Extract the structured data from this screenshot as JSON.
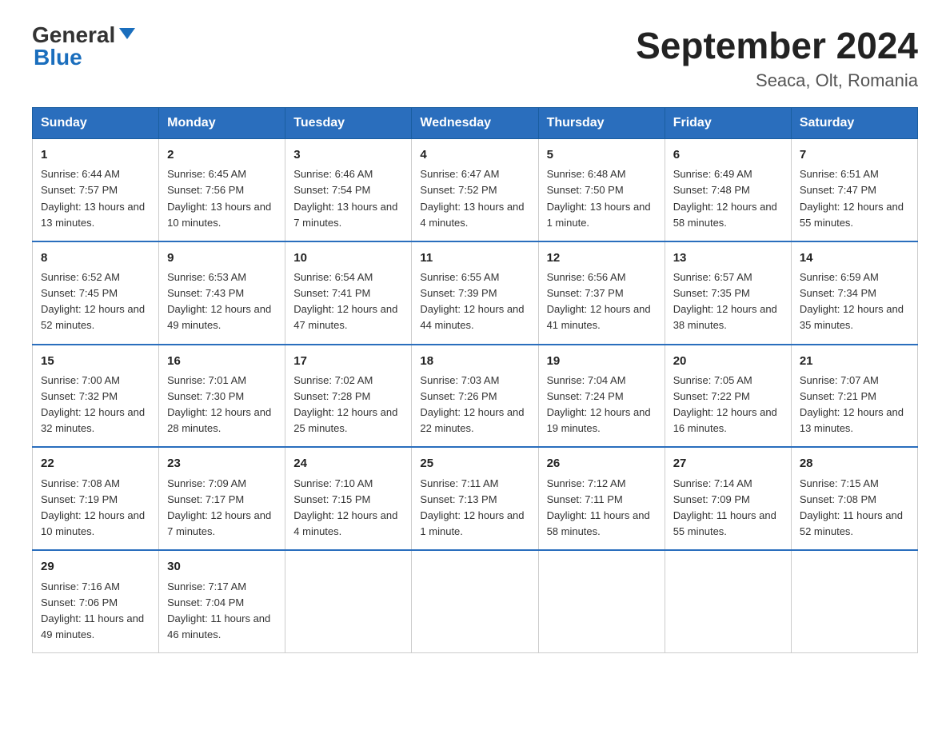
{
  "logo": {
    "general": "General",
    "blue": "Blue"
  },
  "title": "September 2024",
  "subtitle": "Seaca, Olt, Romania",
  "days": [
    "Sunday",
    "Monday",
    "Tuesday",
    "Wednesday",
    "Thursday",
    "Friday",
    "Saturday"
  ],
  "weeks": [
    [
      {
        "day": "1",
        "sunrise": "6:44 AM",
        "sunset": "7:57 PM",
        "daylight": "13 hours and 13 minutes."
      },
      {
        "day": "2",
        "sunrise": "6:45 AM",
        "sunset": "7:56 PM",
        "daylight": "13 hours and 10 minutes."
      },
      {
        "day": "3",
        "sunrise": "6:46 AM",
        "sunset": "7:54 PM",
        "daylight": "13 hours and 7 minutes."
      },
      {
        "day": "4",
        "sunrise": "6:47 AM",
        "sunset": "7:52 PM",
        "daylight": "13 hours and 4 minutes."
      },
      {
        "day": "5",
        "sunrise": "6:48 AM",
        "sunset": "7:50 PM",
        "daylight": "13 hours and 1 minute."
      },
      {
        "day": "6",
        "sunrise": "6:49 AM",
        "sunset": "7:48 PM",
        "daylight": "12 hours and 58 minutes."
      },
      {
        "day": "7",
        "sunrise": "6:51 AM",
        "sunset": "7:47 PM",
        "daylight": "12 hours and 55 minutes."
      }
    ],
    [
      {
        "day": "8",
        "sunrise": "6:52 AM",
        "sunset": "7:45 PM",
        "daylight": "12 hours and 52 minutes."
      },
      {
        "day": "9",
        "sunrise": "6:53 AM",
        "sunset": "7:43 PM",
        "daylight": "12 hours and 49 minutes."
      },
      {
        "day": "10",
        "sunrise": "6:54 AM",
        "sunset": "7:41 PM",
        "daylight": "12 hours and 47 minutes."
      },
      {
        "day": "11",
        "sunrise": "6:55 AM",
        "sunset": "7:39 PM",
        "daylight": "12 hours and 44 minutes."
      },
      {
        "day": "12",
        "sunrise": "6:56 AM",
        "sunset": "7:37 PM",
        "daylight": "12 hours and 41 minutes."
      },
      {
        "day": "13",
        "sunrise": "6:57 AM",
        "sunset": "7:35 PM",
        "daylight": "12 hours and 38 minutes."
      },
      {
        "day": "14",
        "sunrise": "6:59 AM",
        "sunset": "7:34 PM",
        "daylight": "12 hours and 35 minutes."
      }
    ],
    [
      {
        "day": "15",
        "sunrise": "7:00 AM",
        "sunset": "7:32 PM",
        "daylight": "12 hours and 32 minutes."
      },
      {
        "day": "16",
        "sunrise": "7:01 AM",
        "sunset": "7:30 PM",
        "daylight": "12 hours and 28 minutes."
      },
      {
        "day": "17",
        "sunrise": "7:02 AM",
        "sunset": "7:28 PM",
        "daylight": "12 hours and 25 minutes."
      },
      {
        "day": "18",
        "sunrise": "7:03 AM",
        "sunset": "7:26 PM",
        "daylight": "12 hours and 22 minutes."
      },
      {
        "day": "19",
        "sunrise": "7:04 AM",
        "sunset": "7:24 PM",
        "daylight": "12 hours and 19 minutes."
      },
      {
        "day": "20",
        "sunrise": "7:05 AM",
        "sunset": "7:22 PM",
        "daylight": "12 hours and 16 minutes."
      },
      {
        "day": "21",
        "sunrise": "7:07 AM",
        "sunset": "7:21 PM",
        "daylight": "12 hours and 13 minutes."
      }
    ],
    [
      {
        "day": "22",
        "sunrise": "7:08 AM",
        "sunset": "7:19 PM",
        "daylight": "12 hours and 10 minutes."
      },
      {
        "day": "23",
        "sunrise": "7:09 AM",
        "sunset": "7:17 PM",
        "daylight": "12 hours and 7 minutes."
      },
      {
        "day": "24",
        "sunrise": "7:10 AM",
        "sunset": "7:15 PM",
        "daylight": "12 hours and 4 minutes."
      },
      {
        "day": "25",
        "sunrise": "7:11 AM",
        "sunset": "7:13 PM",
        "daylight": "12 hours and 1 minute."
      },
      {
        "day": "26",
        "sunrise": "7:12 AM",
        "sunset": "7:11 PM",
        "daylight": "11 hours and 58 minutes."
      },
      {
        "day": "27",
        "sunrise": "7:14 AM",
        "sunset": "7:09 PM",
        "daylight": "11 hours and 55 minutes."
      },
      {
        "day": "28",
        "sunrise": "7:15 AM",
        "sunset": "7:08 PM",
        "daylight": "11 hours and 52 minutes."
      }
    ],
    [
      {
        "day": "29",
        "sunrise": "7:16 AM",
        "sunset": "7:06 PM",
        "daylight": "11 hours and 49 minutes."
      },
      {
        "day": "30",
        "sunrise": "7:17 AM",
        "sunset": "7:04 PM",
        "daylight": "11 hours and 46 minutes."
      },
      null,
      null,
      null,
      null,
      null
    ]
  ],
  "labels": {
    "sunrise": "Sunrise:",
    "sunset": "Sunset:",
    "daylight": "Daylight:"
  }
}
